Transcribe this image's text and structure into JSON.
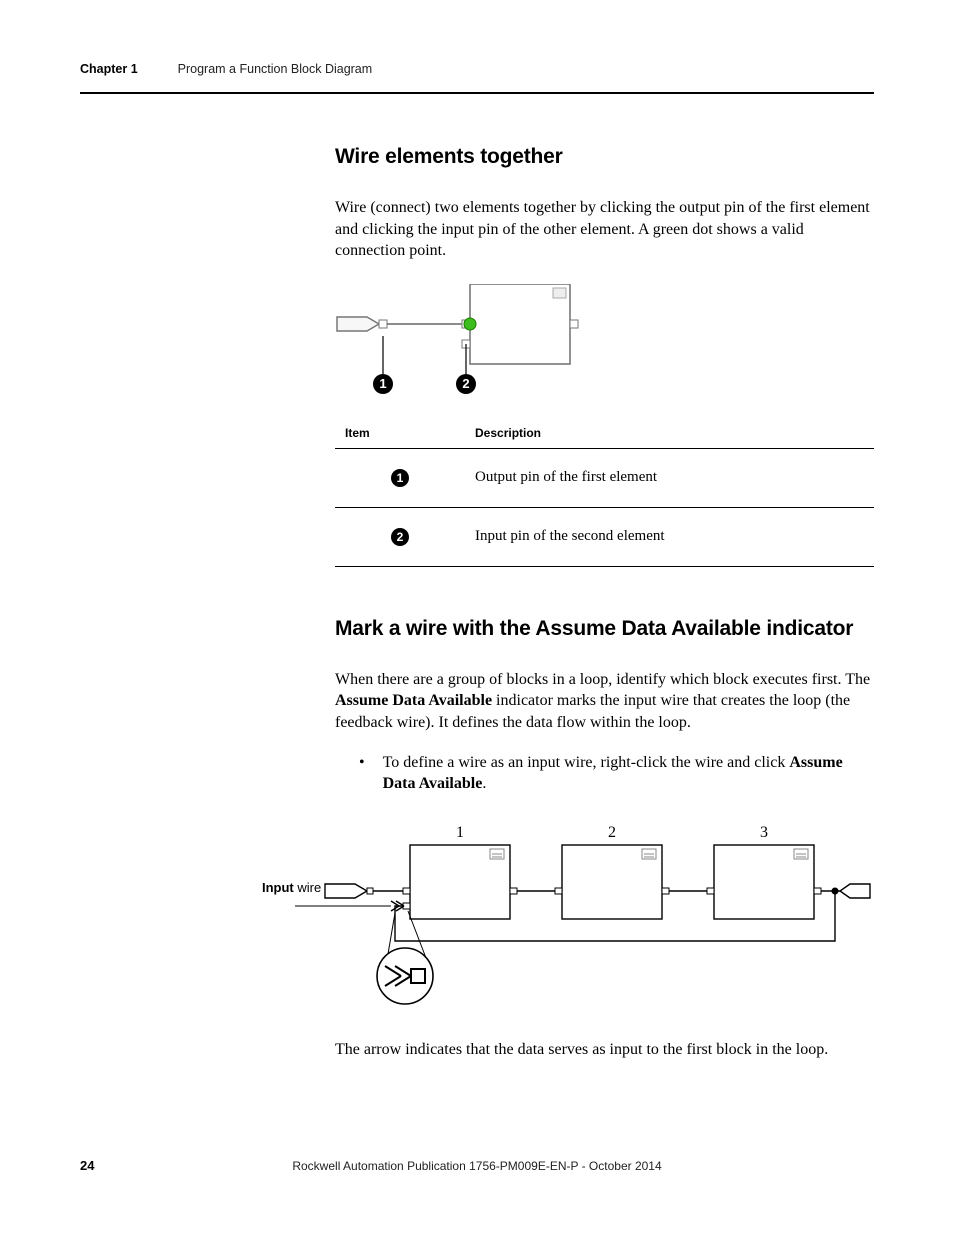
{
  "header": {
    "chapter": "Chapter 1",
    "title": "Program a Function Block Diagram"
  },
  "section1": {
    "heading": "Wire elements together",
    "para": "Wire (connect) two elements together by clicking the output pin of the first element and clicking the input pin of the other element. A green dot shows a valid connection point."
  },
  "table": {
    "head_item": "Item",
    "head_desc": "Description",
    "rows": [
      {
        "num": "1",
        "desc": "Output pin of the first element"
      },
      {
        "num": "2",
        "desc": "Input pin of the second element"
      }
    ]
  },
  "section2": {
    "heading": "Mark a wire with the Assume Data Available indicator",
    "para_a": "When there are a group of blocks in a loop, identify which block executes first. The ",
    "para_b_bold": "Assume Data Available",
    "para_c": " indicator marks the input wire that creates the loop (the feedback wire). It defines the data flow within the loop.",
    "bullet_a": "To define a wire as an input wire, right-click the wire and click ",
    "bullet_b_bold": "Assume Data Available",
    "bullet_c": ".",
    "closing": "The arrow indicates that the data serves as input to the first block in the loop."
  },
  "diag2": {
    "input_label_bold": "Input",
    "input_label_rest": " wire",
    "block_labels": [
      "1",
      "2",
      "3"
    ]
  },
  "footer": {
    "page": "24",
    "pub": "Rockwell Automation Publication 1756-PM009E-EN-P - October 2014"
  }
}
